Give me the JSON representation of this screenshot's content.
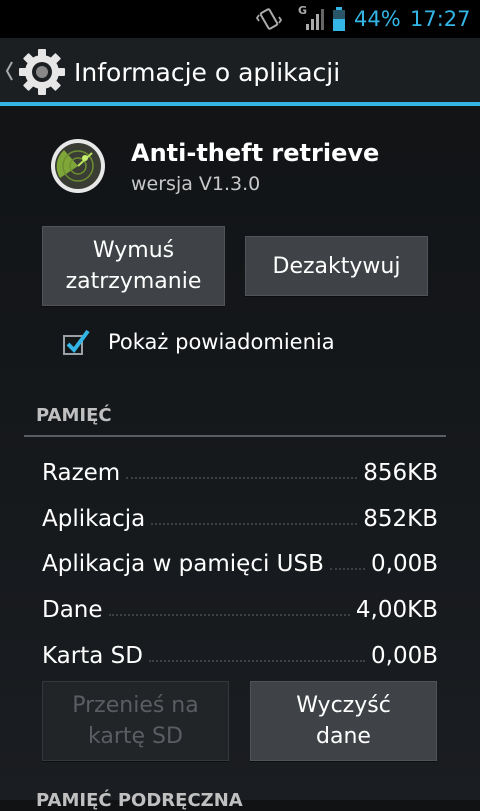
{
  "status_bar": {
    "network_type": "G",
    "battery_percent": "44%",
    "time": "17:27",
    "accent_color": "#33b5e5",
    "icons": [
      "vibrate-icon",
      "signal-icon",
      "battery-icon"
    ]
  },
  "action_bar": {
    "title": "Informacje o aplikacji",
    "icon": "settings-gear-icon"
  },
  "app": {
    "name": "Anti-theft retrieve",
    "version": "wersja V1.3.0",
    "icon": "radar-icon"
  },
  "buttons": {
    "force_stop_line1": "Wymuś",
    "force_stop_line2": "zatrzymanie",
    "disable": "Dezaktywuj",
    "move_line1": "Przenieś na",
    "move_line2": "kartę SD",
    "clear_line1": "Wyczyść",
    "clear_line2": "dane"
  },
  "notifications": {
    "label": "Pokaż powiadomienia",
    "checked": true
  },
  "storage": {
    "title": "PAMIĘĆ",
    "rows": [
      {
        "label": "Razem",
        "value": "856KB"
      },
      {
        "label": "Aplikacja",
        "value": "852KB"
      },
      {
        "label": "Aplikacja w pamięci USB",
        "value": "0,00B"
      },
      {
        "label": "Dane",
        "value": "4,00KB"
      },
      {
        "label": "Karta SD",
        "value": "0,00B"
      }
    ]
  },
  "cache": {
    "title": "PAMIĘĆ PODRĘCZNA"
  }
}
